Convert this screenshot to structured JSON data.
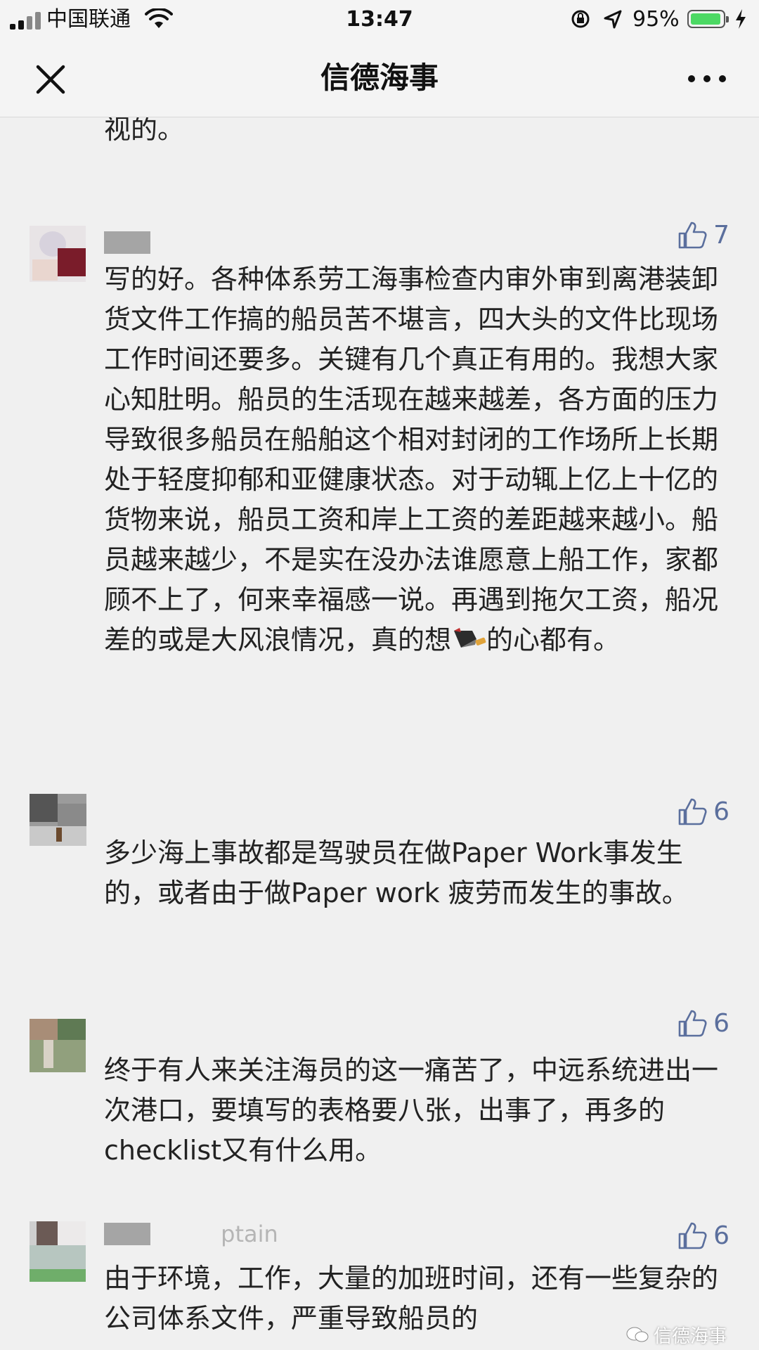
{
  "status_bar": {
    "carrier": "中国联通",
    "time": "13:47",
    "battery_percent": "95%",
    "battery_level": 0.95,
    "icons": [
      "signal-icon",
      "wifi-icon",
      "rotation-lock-icon",
      "location-icon",
      "battery-icon",
      "charging-icon"
    ]
  },
  "nav": {
    "title": "信德海事",
    "close_icon": "close-icon",
    "more_icon": "more-icon"
  },
  "comments": {
    "top_fragment": "视的。",
    "items": [
      {
        "likes": "7",
        "nickname_visible": "",
        "text": "写的好。各种体系劳工海事检查内审外审到离港装卸货文件工作搞的船员苦不堪言，四大头的文件比现场工作时间还要多。关键有几个真正有用的。我想大家心知肚明。船员的生活现在越来越差，各方面的压力导致很多船员在船舶这个相对封闭的工作场所上长期处于轻度抑郁和亚健康状态。对于动辄上亿上十亿的货物来说，船员工资和岸上工资的差距越来越小。船员越来越少，不是实在没办法谁愿意上船工作，家都顾不上了，何来幸福感一说。再遇到拖欠工资，船况差的或是大风浪情况，真的想",
        "text_tail": "的心都有。",
        "emoji": "kitchen-knife-icon"
      },
      {
        "likes": "6",
        "nickname_visible": "",
        "text": "多少海上事故都是驾驶员在做Paper Work事发生的，或者由于做Paper work 疲劳而发生的事故。"
      },
      {
        "likes": "6",
        "nickname_visible": "",
        "text": "终于有人来关注海员的这一痛苦了，中远系统进出一次港口，要填写的表格要八张，出事了，再多的checklist又有什么用。"
      },
      {
        "likes": "6",
        "nickname_visible": "ptain",
        "text": "由于环境，工作，大量的加班时间，还有一些复杂的公司体系文件，严重导致船员的"
      }
    ]
  },
  "watermark": {
    "text": "信德海事",
    "icon": "wechat-icon"
  },
  "colors": {
    "background": "#f0f0f0",
    "like_blue": "#5b6f9d",
    "text": "#222222",
    "battery_green": "#4cd964"
  }
}
